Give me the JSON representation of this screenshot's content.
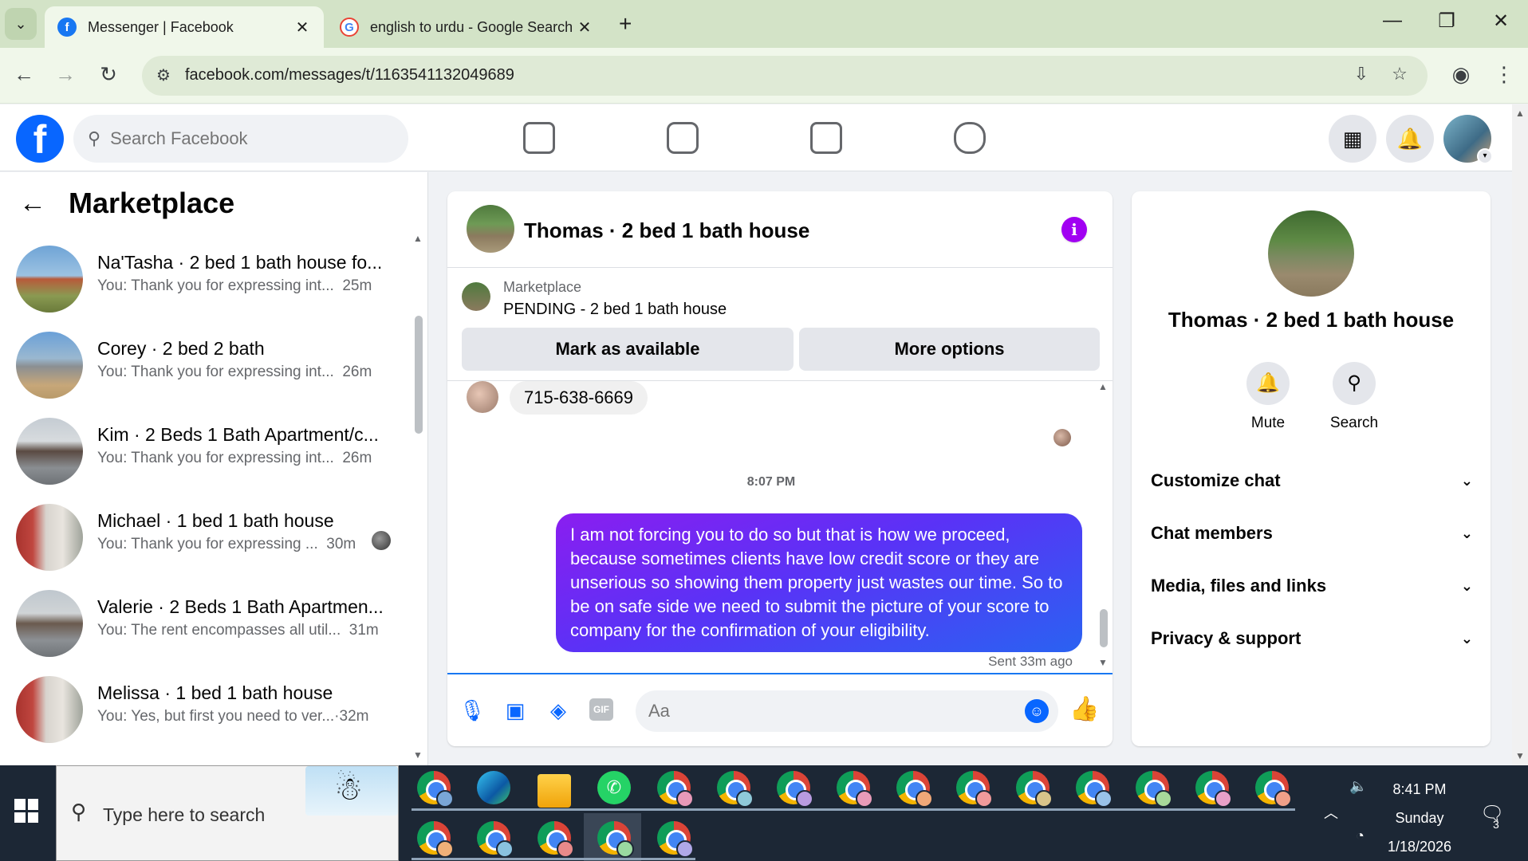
{
  "browser": {
    "tabs": [
      {
        "title": "Messenger | Facebook",
        "favicon": "facebook-icon"
      },
      {
        "title": "english to urdu - Google Search",
        "favicon": "google-icon"
      }
    ],
    "url": "facebook.com/messages/t/1163541132049689"
  },
  "fb_header": {
    "logo": "f",
    "search_placeholder": "Search Facebook",
    "nav_icons": [
      "home-icon",
      "video-icon",
      "marketplace-icon",
      "gaming-icon"
    ]
  },
  "sidebar": {
    "title": "Marketplace",
    "conversations": [
      {
        "name": "Na'Tasha · 2 bed 1 bath house fo...",
        "preview": "You: Thank you for expressing int...",
        "time": "25m"
      },
      {
        "name": "Corey · 2 bed 2 bath",
        "preview": "You: Thank you for expressing int...",
        "time": "26m"
      },
      {
        "name": "Kim · 2 Beds 1 Bath Apartment/c...",
        "preview": "You: Thank you for expressing int...",
        "time": "26m"
      },
      {
        "name": "Michael · 1 bed 1 bath house",
        "preview": "You: Thank you for expressing ...",
        "time": "30m"
      },
      {
        "name": "Valerie · 2 Beds 1 Bath Apartmen...",
        "preview": "You: The rent encompasses all util...",
        "time": "31m"
      },
      {
        "name": "Melissa · 1 bed 1 bath house",
        "preview": "You: Yes, but first you need to ver...",
        "time": "·32m"
      }
    ]
  },
  "chat": {
    "title": "Thomas · 2 bed 1 bath house",
    "listing_label": "Marketplace",
    "listing_status": "PENDING - 2 bed 1 bath house",
    "mark_available_label": "Mark as available",
    "more_options_label": "More options",
    "received_message": "715-638-6669",
    "timestamp": "8:07 PM",
    "sent_message": "I am not forcing you to do so but that is how we proceed, because sometimes clients have low credit score or they are unserious so showing them property just wastes our time. So to be on safe side we need to submit the picture of your score to company for the confirmation of your eligibility.",
    "sent_status": "Sent 33m ago",
    "composer_placeholder": "Aa",
    "gif_label": "GIF"
  },
  "info_panel": {
    "name": "Thomas · 2 bed 1 bath house",
    "mute_label": "Mute",
    "search_label": "Search",
    "sections": [
      "Customize chat",
      "Chat members",
      "Media, files and links",
      "Privacy & support"
    ]
  },
  "taskbar": {
    "search_placeholder": "Type here to search",
    "time": "8:41 PM",
    "day": "Sunday",
    "date": "1/18/2026",
    "notification_count": "3"
  },
  "colors": {
    "fb_blue": "#0866ff",
    "bubble_start": "#8a1ef0",
    "bubble_end": "#2a62f2",
    "info_purple": "#a100f2"
  }
}
